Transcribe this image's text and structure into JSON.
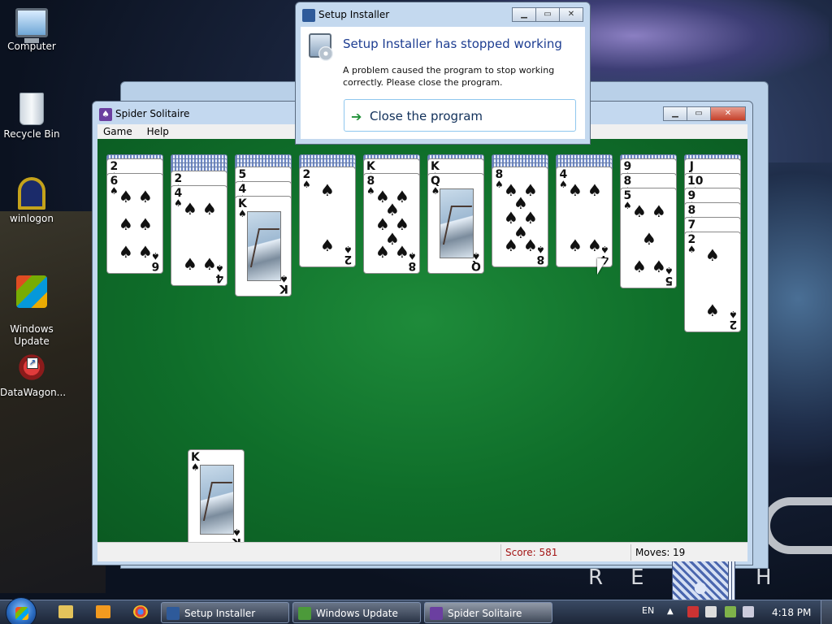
{
  "desktop": {
    "icons": [
      {
        "label": "Computer",
        "icon": "computer-icon"
      },
      {
        "label": "Recycle Bin",
        "icon": "recycle-bin-icon"
      },
      {
        "label": "winlogon",
        "icon": "winlogon-icon"
      },
      {
        "label": "Windows\nUpdate",
        "icon": "windows-update-icon"
      },
      {
        "label": "DataWagon...",
        "icon": "datawagon-icon"
      }
    ],
    "wallpaper_text": "REACH"
  },
  "spider_window": {
    "title": "Spider Solitaire",
    "menu": [
      "Game",
      "Help"
    ],
    "status": {
      "score_text": "Score: 581",
      "moves_label": "Moves:",
      "moves_value": "19"
    },
    "tableau": [
      {
        "hidden": 1,
        "cards": [
          "2",
          "6"
        ]
      },
      {
        "hidden": 4,
        "cards": [
          "2",
          "4"
        ]
      },
      {
        "hidden": 3,
        "cards": [
          "5",
          "4",
          "K"
        ]
      },
      {
        "hidden": 3,
        "cards": [
          "2"
        ]
      },
      {
        "hidden": 1,
        "cards": [
          "K",
          "8"
        ]
      },
      {
        "hidden": 1,
        "cards": [
          "K",
          "Q"
        ]
      },
      {
        "hidden": 3,
        "cards": [
          "8"
        ]
      },
      {
        "hidden": 3,
        "cards": [
          "4"
        ]
      },
      {
        "hidden": 1,
        "cards": [
          "9",
          "8",
          "5"
        ]
      },
      {
        "hidden": 1,
        "cards": [
          "J",
          "10",
          "9",
          "8",
          "7",
          "2"
        ]
      }
    ],
    "foundation_card": "K",
    "suit_symbol": "♠"
  },
  "dialog": {
    "title": "Setup Installer",
    "heading": "Setup Installer has stopped working",
    "body": "A problem caused the program to stop working correctly. Please close the program.",
    "action_label": "Close the program"
  },
  "taskbar": {
    "buttons": [
      {
        "label": "Setup Installer",
        "active": false
      },
      {
        "label": "Windows Update",
        "active": false
      },
      {
        "label": "Spider Solitaire",
        "active": true
      }
    ],
    "language": "EN",
    "clock": "4:18 PM"
  },
  "colors": {
    "felt": "#0f6e2a",
    "score": "#a31515",
    "dialog_heading": "#1d3d91"
  }
}
